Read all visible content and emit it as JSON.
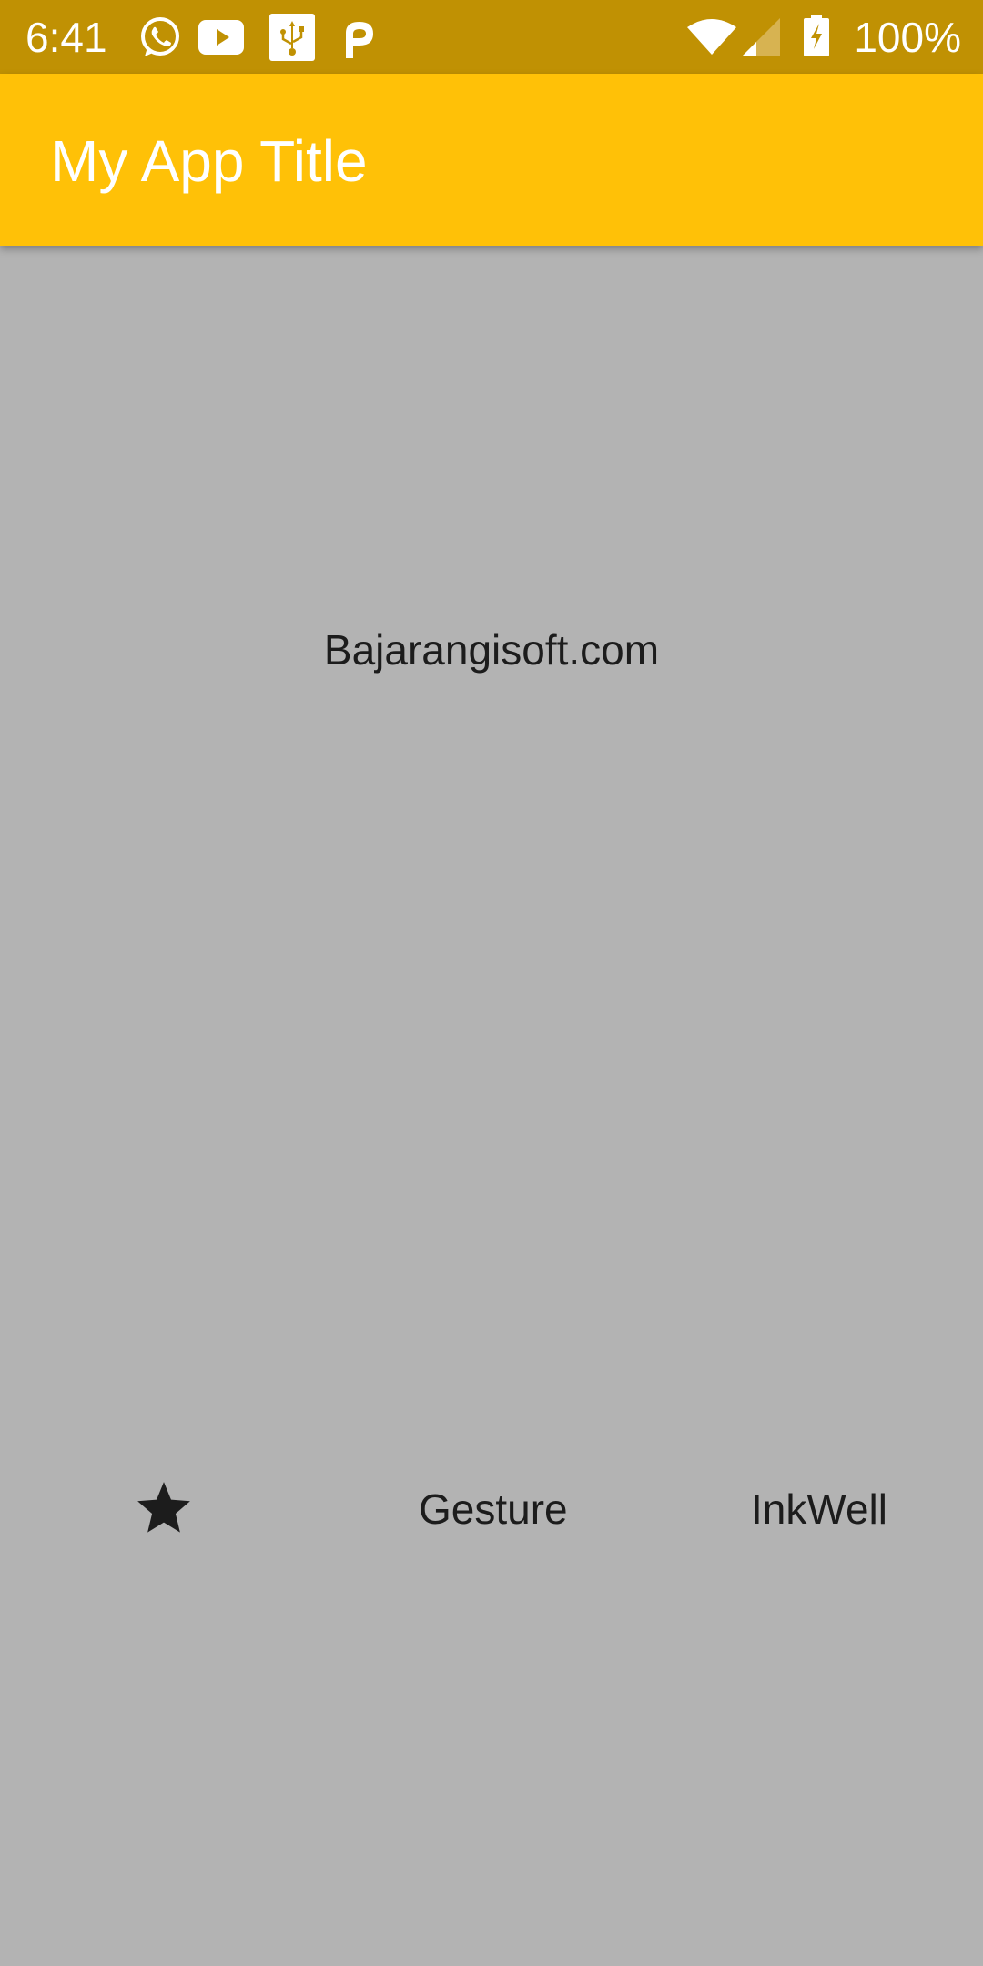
{
  "status_bar": {
    "time": "6:41",
    "notification_icons": [
      "whatsapp-icon",
      "youtube-icon",
      "usb-icon",
      "parking-icon"
    ],
    "system_icons": [
      "wifi-icon",
      "cell-signal-icon",
      "battery-charging-icon"
    ],
    "battery": "100%"
  },
  "app_bar": {
    "title": "My App Title",
    "color": "#ffc107"
  },
  "body": {
    "center_text": "Bajarangisoft.com",
    "row": {
      "icon": "star-icon",
      "gesture_label": "Gesture",
      "inkwell_label": "InkWell"
    },
    "background": "#b3b3b3"
  }
}
